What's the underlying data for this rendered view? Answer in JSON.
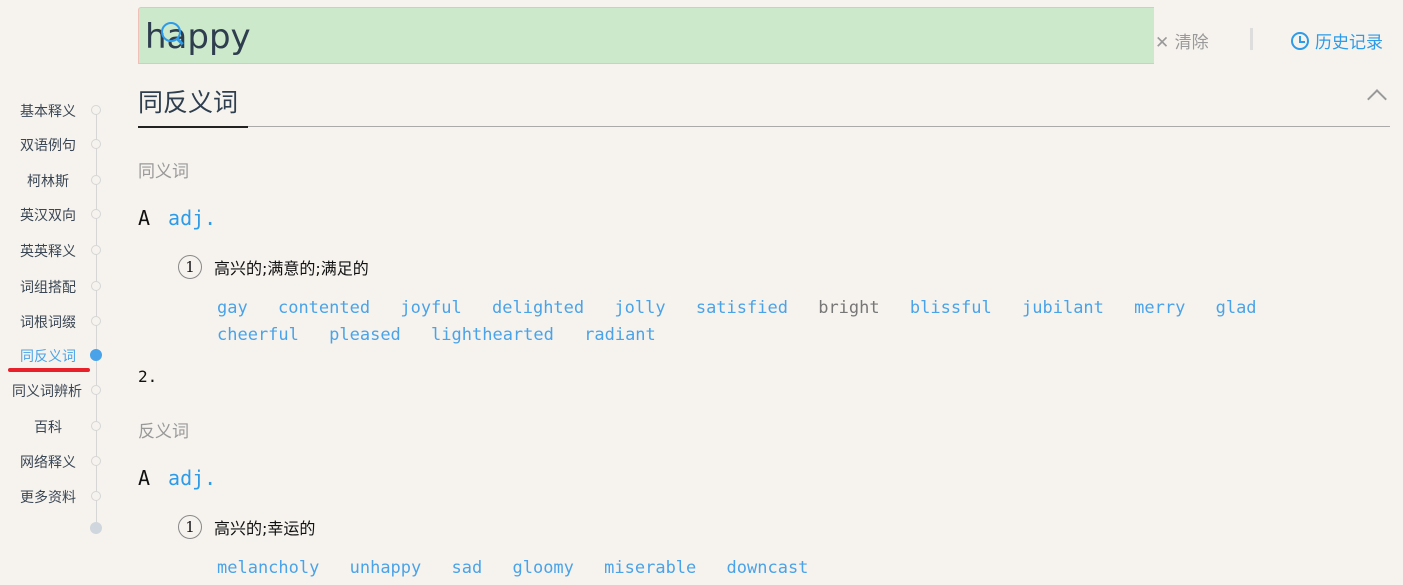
{
  "search": {
    "value": "happy",
    "clear_label": "清除",
    "history_label": "历史记录"
  },
  "nav": {
    "items": [
      "基本释义",
      "双语例句",
      "柯林斯",
      "英汉双向",
      "英英释义",
      "词组搭配",
      "词根词缀",
      "同反义词",
      "同义词辨析",
      "百科",
      "网络释义",
      "更多资料"
    ],
    "active_index": 7
  },
  "section": {
    "title": "同反义词",
    "synonyms": {
      "label": "同义词",
      "letter": "A",
      "pos": "adj.",
      "num": "1",
      "definition": "高兴的;满意的;满足的",
      "words": [
        "gay",
        "contented",
        "joyful",
        "delighted",
        "jolly",
        "satisfied",
        "bright",
        "blissful",
        "jubilant",
        "merry",
        "glad",
        "cheerful",
        "pleased",
        "lighthearted",
        "radiant"
      ]
    },
    "second_num": "2.",
    "antonyms": {
      "label": "反义词",
      "letter": "A",
      "pos": "adj.",
      "num": "1",
      "definition": "高兴的;幸运的",
      "words": [
        "melancholy",
        "unhappy",
        "sad",
        "gloomy",
        "miserable",
        "downcast"
      ]
    }
  },
  "colors": {
    "accent": "#2d9be8",
    "search_bg": "#cce9cc",
    "highlight": "#e8202a"
  }
}
